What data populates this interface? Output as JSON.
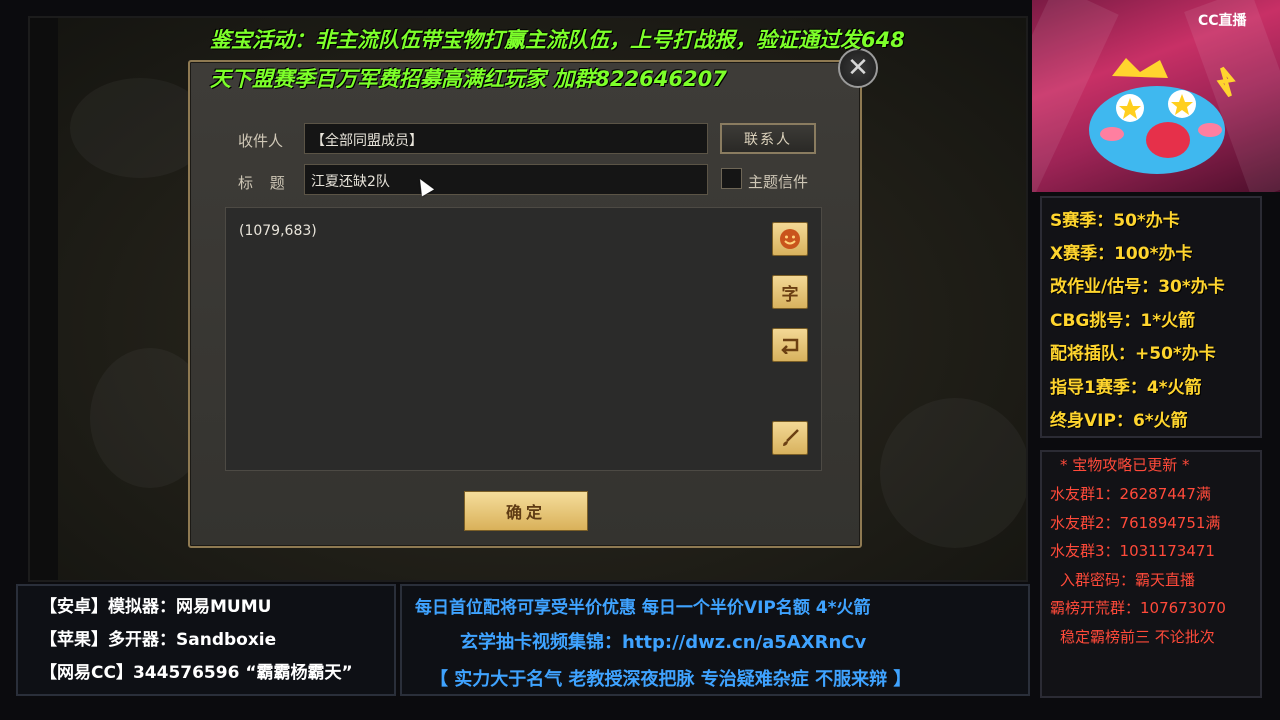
{
  "promo": {
    "line1": "鉴宝活动：非主流队伍带宝物打赢主流队伍，上号打战报，验证通过发648",
    "line2": "天下盟赛季百万军费招募高满红玩家 加群822646207"
  },
  "mail_dialog": {
    "recipient_label": "收件人",
    "recipient_value": "【全部同盟成员】",
    "contact_button": "联系人",
    "subject_label": "标 题",
    "subject_value": "江夏还缺2队",
    "theme_mail_label": "主题信件",
    "theme_mail_checked": false,
    "body_text": "(1079,683)",
    "tool_text_label": "字",
    "confirm_button": "确定",
    "close_symbol": "✕"
  },
  "stream": {
    "cc_logo": "CC直播",
    "price_list": [
      "S赛季：50*办卡",
      "X赛季：100*办卡",
      "改作业/估号：30*办卡",
      "CBG挑号：1*火箭",
      "配将插队：+50*办卡",
      "指导1赛季：4*火箭",
      "终身VIP：6*火箭"
    ],
    "info_list": [
      "* 宝物攻略已更新 *",
      "水友群1：26287447满",
      "水友群2：761894751满",
      "水友群3：1031173471",
      "入群密码：霸天直播",
      "霸榜开荒群：107673070",
      "稳定霸榜前三 不论批次"
    ],
    "bottom_left": [
      "【安卓】模拟器：网易MUMU",
      "【苹果】多开器：Sandboxie",
      "【网易CC】344576596 “霸霸杨霸天”"
    ],
    "bottom_mid": [
      "每日首位配将可享受半价优惠 每日一个半价VIP名额 4*火箭",
      "玄学抽卡视频集锦：http://dwz.cn/a5AXRnCv",
      "【 实力大于名气 老教授深夜把脉 专治疑难杂症 不服来辩 】"
    ]
  },
  "colors": {
    "promo_green": "#7dff2a",
    "price_yellow": "#ffd52e",
    "info_red": "#ff4a3a",
    "blue_text": "#3fa3ff",
    "gold_button": "#e3c26f"
  }
}
